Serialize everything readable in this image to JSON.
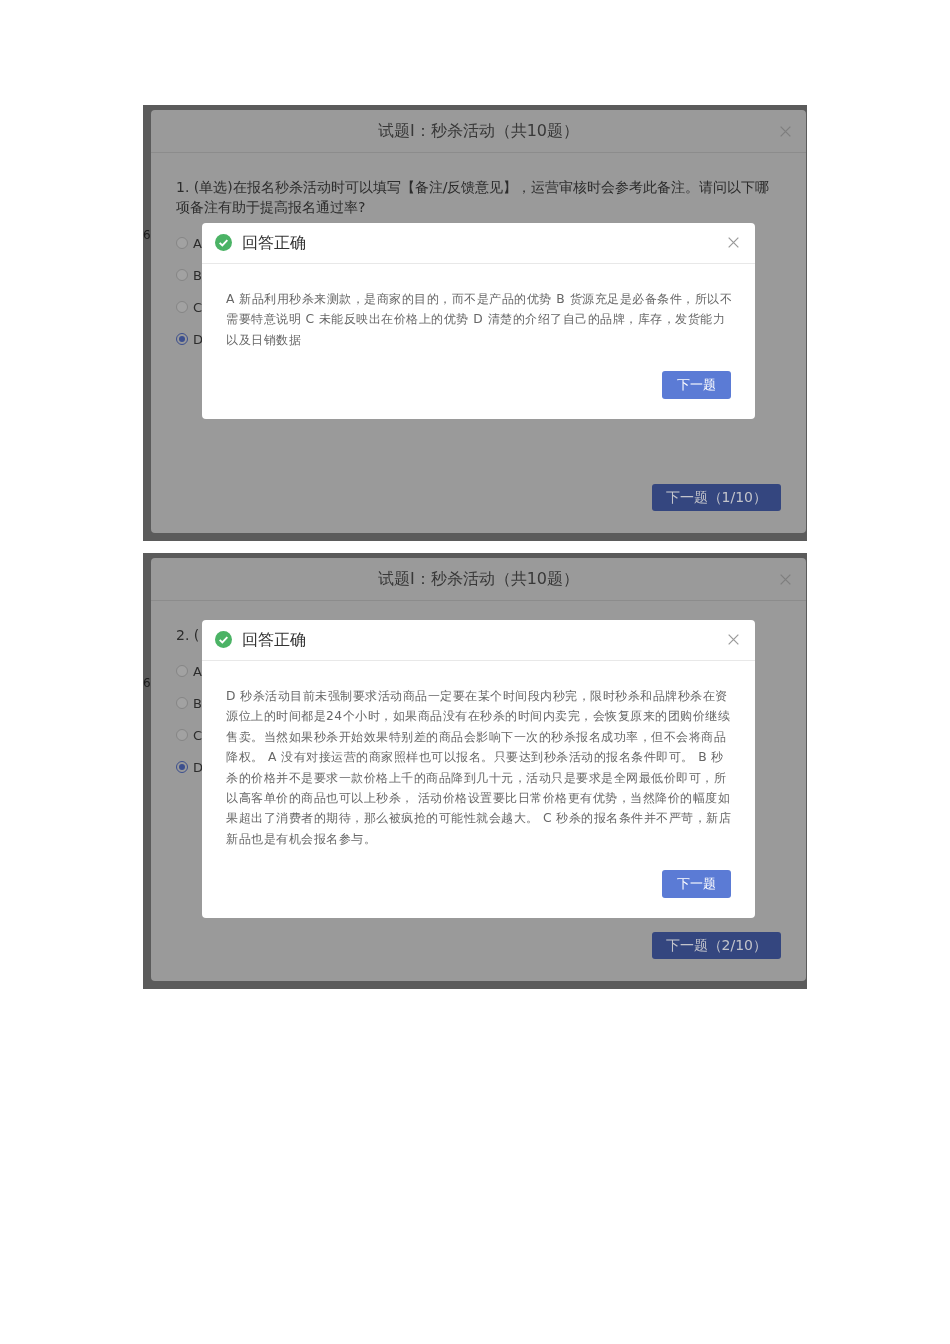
{
  "screenshots": [
    {
      "left_edge_text": "6",
      "dialog": {
        "title": "试题I：秒杀活动（共10题）",
        "question": "1. (单选)在报名秒杀活动时可以填写【备注/反馈意见】，运营审核时会参考此备注。请问以下哪项备注有助于提高报名通过率?",
        "options": [
          {
            "label": "A",
            "selected": false
          },
          {
            "label": "B",
            "selected": false
          },
          {
            "label": "C",
            "selected": false
          },
          {
            "label": "D",
            "selected": true
          }
        ],
        "next_button": "下一题（1/10）"
      },
      "popup": {
        "kind": "correct",
        "title": "回答正确",
        "explanation": "A 新品利用秒杀来测款，是商家的目的，而不是产品的优势 B 货源充足是必备条件，所以不需要特意说明 C 未能反映出在价格上的优势 D 清楚的介绍了自己的品牌，库存，发货能力以及日销数据",
        "button": "下一题"
      }
    },
    {
      "left_edge_text": "6",
      "dialog": {
        "title": "试题I：秒杀活动（共10题）",
        "question": "2. (",
        "options": [
          {
            "label": "A",
            "selected": false
          },
          {
            "label": "B",
            "selected": false
          },
          {
            "label": "C",
            "selected": false
          },
          {
            "label": "D",
            "selected": true
          }
        ],
        "next_button": "下一题（2/10）"
      },
      "popup": {
        "kind": "correct",
        "title": "回答正确",
        "explanation": "D 秒杀活动目前未强制要求活动商品一定要在某个时间段内秒完，限时秒杀和品牌秒杀在资源位上的时间都是24个小时，如果商品没有在秒杀的时间内卖完，会恢复原来的团购价继续售卖。当然如果秒杀开始效果特别差的商品会影响下一次的秒杀报名成功率，但不会将商品降权。 A 没有对接运营的商家照样也可以报名。只要达到秒杀活动的报名条件即可。 B 秒杀的价格并不是要求一款价格上千的商品降到几十元，活动只是要求是全网最低价即可，所以高客单价的商品也可以上秒杀， 活动价格设置要比日常价格更有优势，当然降价的幅度如果超出了消费者的期待，那么被疯抢的可能性就会越大。 C 秒杀的报名条件并不严苛，新店新品也是有机会报名参与。",
        "button": "下一题"
      }
    }
  ]
}
